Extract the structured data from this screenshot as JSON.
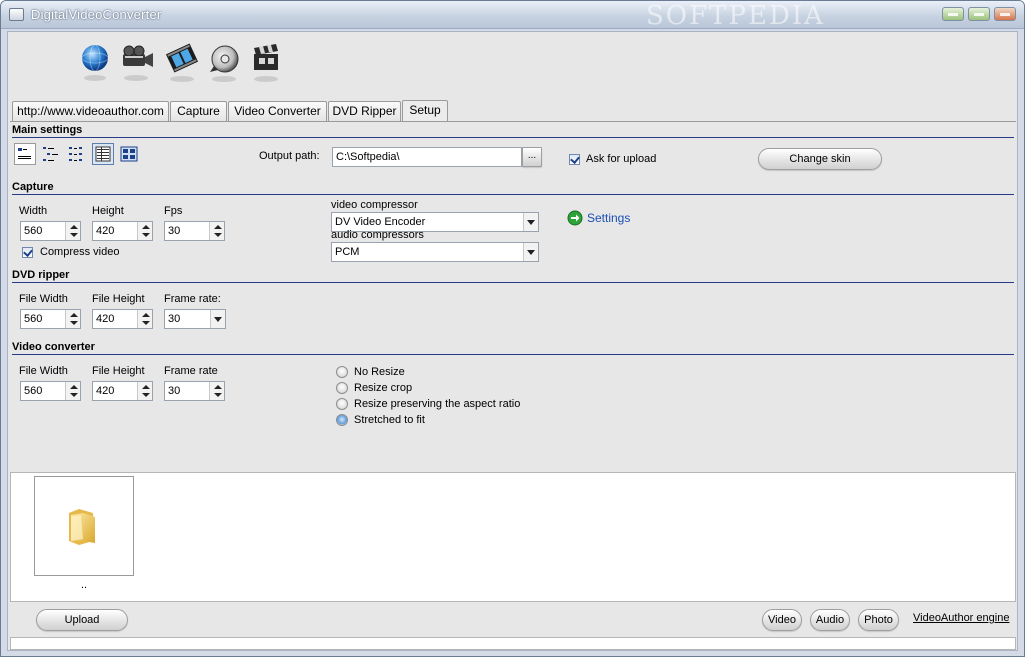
{
  "window": {
    "title": "DigitalVideoConverter",
    "watermark": "SOFTPEDIA"
  },
  "toolbar": {
    "icons": [
      "globe-icon",
      "camera-icon",
      "film-icon",
      "disc-icon",
      "clapper-icon"
    ]
  },
  "tabs": [
    {
      "label": "http://www.videoauthor.com"
    },
    {
      "label": "Capture"
    },
    {
      "label": "Video Converter"
    },
    {
      "label": "DVD Ripper"
    },
    {
      "label": "Setup",
      "active": true
    }
  ],
  "main_settings": {
    "title": "Main settings",
    "view_buttons": [
      "view-small-icons",
      "view-list",
      "view-details",
      "view-report",
      "view-thumbnails"
    ],
    "output_path_label": "Output path:",
    "output_path": "C:\\Softpedia\\",
    "browse_label": "...",
    "ask_upload_label": "Ask for upload",
    "ask_upload_checked": true,
    "change_skin_label": "Change skin"
  },
  "capture": {
    "title": "Capture",
    "width_label": "Width",
    "height_label": "Height",
    "fps_label": "Fps",
    "width": "560",
    "height": "420",
    "fps": "30",
    "compress_label": "Compress video",
    "compress_checked": true,
    "video_compressor_label": "video compressor",
    "video_compressor": "DV Video Encoder",
    "audio_compressor_label": "audio compressors",
    "audio_compressor": "PCM",
    "settings_label": "Settings"
  },
  "dvd_ripper": {
    "title": "DVD ripper",
    "width_label": "File Width",
    "height_label": "File Height",
    "rate_label": "Frame rate:",
    "width": "560",
    "height": "420",
    "rate": "30"
  },
  "video_converter": {
    "title": "Video converter",
    "width_label": "File Width",
    "height_label": "File Height",
    "rate_label": "Frame rate",
    "width": "560",
    "height": "420",
    "rate": "30",
    "resize_options": [
      {
        "label": "No Resize",
        "selected": false
      },
      {
        "label": "Resize crop",
        "selected": false
      },
      {
        "label": "Resize preserving the aspect ratio",
        "selected": false
      },
      {
        "label": "Stretched to fit",
        "selected": true
      }
    ]
  },
  "files": {
    "items": [
      {
        "label": ".."
      }
    ]
  },
  "bottom": {
    "upload_label": "Upload",
    "video_label": "Video",
    "audio_label": "Audio",
    "photo_label": "Photo",
    "engine_label": "VideoAuthor engine"
  },
  "colors": {
    "section_line": "#283b8a",
    "link": "#1b4fb3",
    "title_bar": "#c8d3e2"
  }
}
